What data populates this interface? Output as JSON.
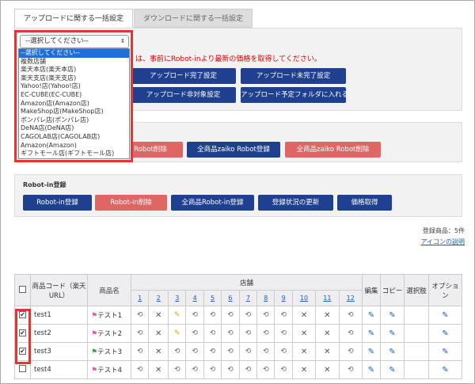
{
  "tabs": {
    "upload": "アップロードに関する一括設定",
    "download": "ダウンロードに関する一括設定"
  },
  "dropdown": {
    "selected": "--選択してください--",
    "options": [
      "--選択してください--",
      "複数店舗",
      "楽天本店(楽天本店)",
      "楽天支店(楽天支店)",
      "Yahoo!店(Yahoo!店)",
      "EC-CUBE(EC-CUBE)",
      "Amazon店(Amazon店)",
      "MakeShop店(MakeShop店)",
      "ポンパレ店(ポンパレ店)",
      "DeNA店(DeNA店)",
      "CAGOLAB店(CAGOLAB店)",
      "Amazon(Amazon)",
      "ギフトモール店(ギフトモール店)"
    ]
  },
  "warning": "は、事前にRobot-inより最新の価格を取得してください。",
  "upload_buttons": [
    "アップロード完了設定",
    "アップロード未完了設定",
    "アップロード非対象設定",
    "アップロード予定フォルダに入れる"
  ],
  "zaiko_buttons": [
    "o Robot削除",
    "全商品zaiko Robot登録",
    "全商品zaiko Robot削除"
  ],
  "robotin": {
    "label": "Robot-in登録",
    "buttons": [
      "Robot-in登録",
      "Robot-in削除",
      "全商品Robot-in登録",
      "登録状況の更新",
      "価格取得"
    ]
  },
  "summary": {
    "count": "登録商品：5件",
    "help_link": "アイコンの説明"
  },
  "table": {
    "headers": {
      "code": "商品コード（楽天URL）",
      "name": "商品名",
      "store": "店舗",
      "edit": "編集",
      "copy": "コピー",
      "option": "選択肢",
      "other": "オプション"
    },
    "store_numbers": [
      "1",
      "2",
      "3",
      "4",
      "5",
      "6",
      "7",
      "8",
      "9",
      "10",
      "11",
      "12"
    ],
    "rows": [
      {
        "code": "test1",
        "name": "テスト1",
        "checked": "✔"
      },
      {
        "code": "test2",
        "name": "テスト2",
        "checked": "✔"
      },
      {
        "code": "test3",
        "name": "テスト3",
        "checked": "✔"
      },
      {
        "code": "test4",
        "name": "テスト4",
        "checked": ""
      }
    ]
  }
}
